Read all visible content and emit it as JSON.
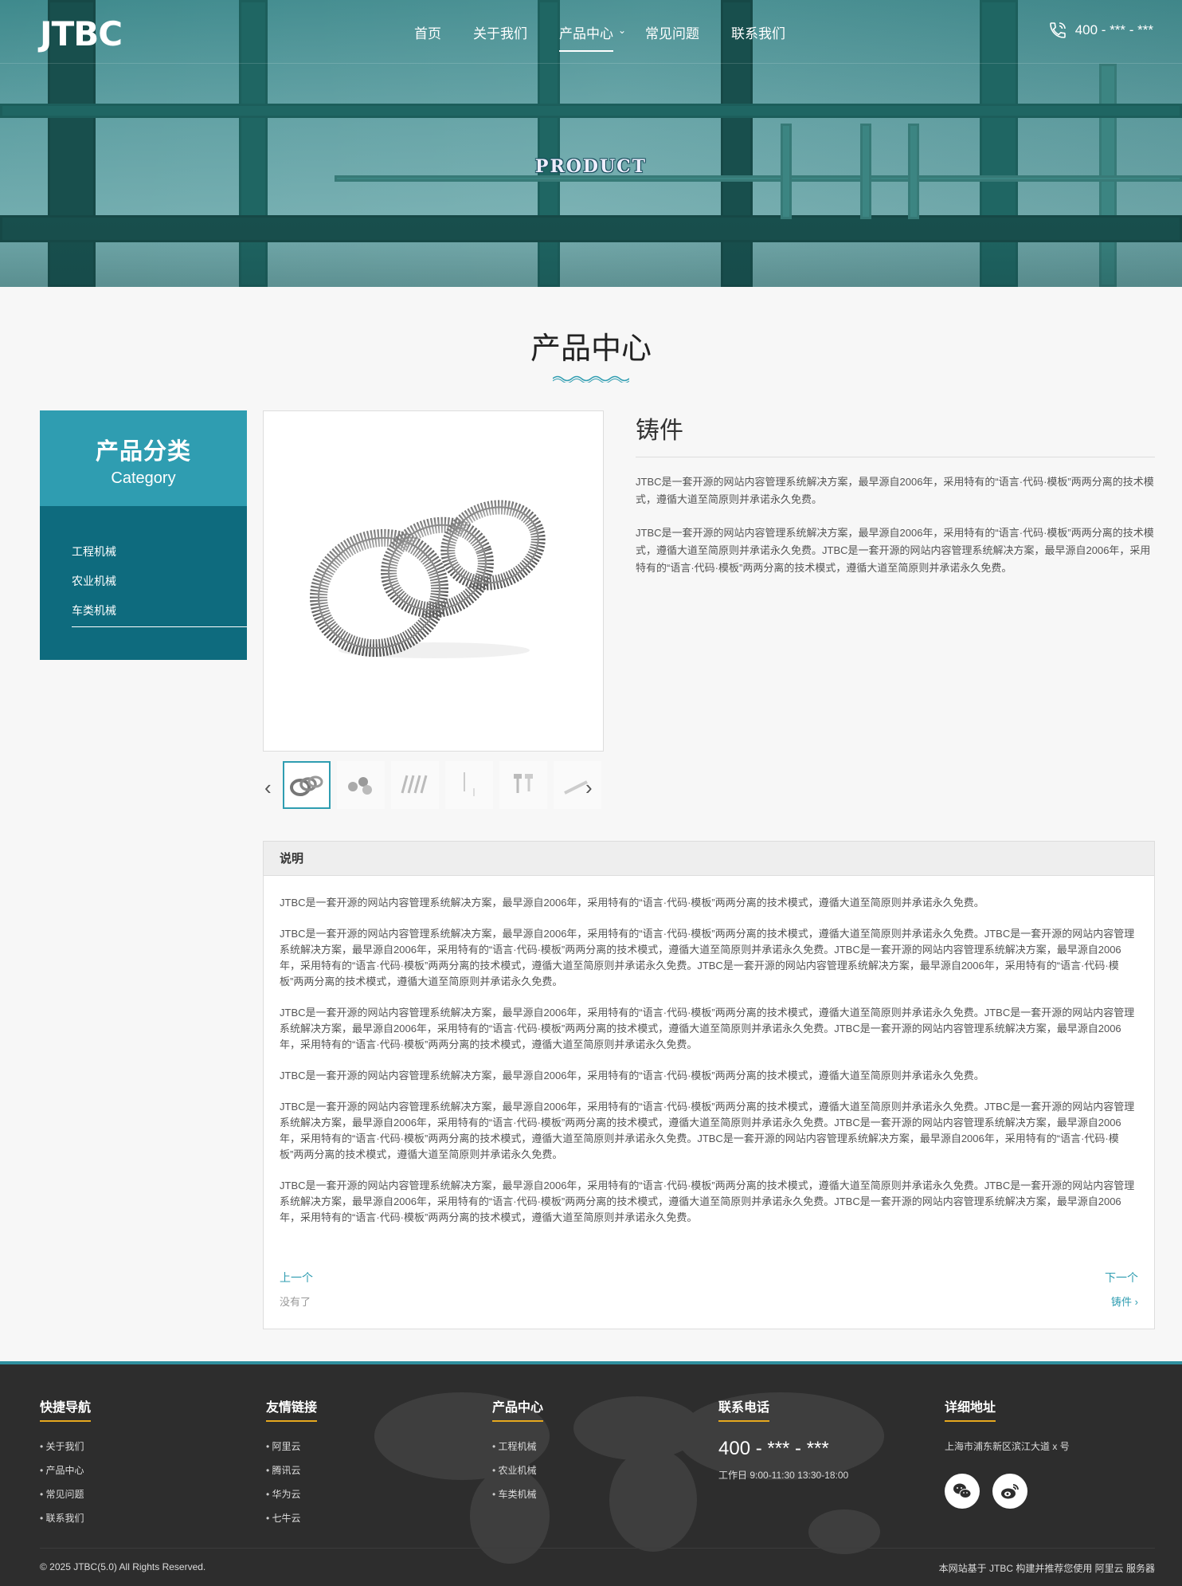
{
  "header": {
    "logo": "JTBC",
    "nav": [
      {
        "label": "首页"
      },
      {
        "label": "关于我们"
      },
      {
        "label": "产品中心"
      },
      {
        "label": "常见问题"
      },
      {
        "label": "联系我们"
      }
    ],
    "phone": "400 - *** - ***",
    "banner_label": "PRODUCT"
  },
  "page_title": "产品中心",
  "sidebar": {
    "title_cn": "产品分类",
    "title_en": "Category",
    "items": [
      {
        "label": "工程机械"
      },
      {
        "label": "农业机械"
      },
      {
        "label": "车类机械"
      }
    ]
  },
  "product": {
    "name": "铸件",
    "paragraphs": [
      "JTBC是一套开源的网站内容管理系统解决方案，最早源自2006年，采用特有的“语言·代码·模板”两两分离的技术模式，遵循大道至简原则并承诺永久免费。",
      "JTBC是一套开源的网站内容管理系统解决方案，最早源自2006年，采用特有的“语言·代码·模板”两两分离的技术模式，遵循大道至简原则并承诺永久免费。JTBC是一套开源的网站内容管理系统解决方案，最早源自2006年，采用特有的“语言·代码·模板”两两分离的技术模式，遵循大道至简原则并承诺永久免费。"
    ]
  },
  "description": {
    "heading": "说明",
    "paragraphs": [
      "JTBC是一套开源的网站内容管理系统解决方案，最早源自2006年，采用特有的“语言·代码·模板”两两分离的技术模式，遵循大道至简原则并承诺永久免费。",
      "JTBC是一套开源的网站内容管理系统解决方案，最早源自2006年，采用特有的“语言·代码·模板”两两分离的技术模式，遵循大道至简原则并承诺永久免费。JTBC是一套开源的网站内容管理系统解决方案，最早源自2006年，采用特有的“语言·代码·模板”两两分离的技术模式，遵循大道至简原则并承诺永久免费。JTBC是一套开源的网站内容管理系统解决方案，最早源自2006年，采用特有的“语言·代码·模板”两两分离的技术模式，遵循大道至简原则并承诺永久免费。JTBC是一套开源的网站内容管理系统解决方案，最早源自2006年，采用特有的“语言·代码·模板”两两分离的技术模式，遵循大道至简原则并承诺永久免费。",
      "JTBC是一套开源的网站内容管理系统解决方案，最早源自2006年，采用特有的“语言·代码·模板”两两分离的技术模式，遵循大道至简原则并承诺永久免费。JTBC是一套开源的网站内容管理系统解决方案，最早源自2006年，采用特有的“语言·代码·模板”两两分离的技术模式，遵循大道至简原则并承诺永久免费。JTBC是一套开源的网站内容管理系统解决方案，最早源自2006年，采用特有的“语言·代码·模板”两两分离的技术模式，遵循大道至简原则并承诺永久免费。",
      "JTBC是一套开源的网站内容管理系统解决方案，最早源自2006年，采用特有的“语言·代码·模板”两两分离的技术模式，遵循大道至简原则并承诺永久免费。",
      "JTBC是一套开源的网站内容管理系统解决方案，最早源自2006年，采用特有的“语言·代码·模板”两两分离的技术模式，遵循大道至简原则并承诺永久免费。JTBC是一套开源的网站内容管理系统解决方案，最早源自2006年，采用特有的“语言·代码·模板”两两分离的技术模式，遵循大道至简原则并承诺永久免费。JTBC是一套开源的网站内容管理系统解决方案，最早源自2006年，采用特有的“语言·代码·模板”两两分离的技术模式，遵循大道至简原则并承诺永久免费。JTBC是一套开源的网站内容管理系统解决方案，最早源自2006年，采用特有的“语言·代码·模板”两两分离的技术模式，遵循大道至简原则并承诺永久免费。",
      "JTBC是一套开源的网站内容管理系统解决方案，最早源自2006年，采用特有的“语言·代码·模板”两两分离的技术模式，遵循大道至简原则并承诺永久免费。JTBC是一套开源的网站内容管理系统解决方案，最早源自2006年，采用特有的“语言·代码·模板”两两分离的技术模式，遵循大道至简原则并承诺永久免费。JTBC是一套开源的网站内容管理系统解决方案，最早源自2006年，采用特有的“语言·代码·模板”两两分离的技术模式，遵循大道至简原则并承诺永久免费。"
    ],
    "prev_label": "上一个",
    "prev_value": "没有了",
    "next_label": "下一个",
    "next_value": "铸件"
  },
  "footer": {
    "quick_nav": {
      "title": "快捷导航",
      "items": [
        "关于我们",
        "产品中心",
        "常见问题",
        "联系我们"
      ]
    },
    "links": {
      "title": "友情链接",
      "items": [
        "阿里云",
        "腾讯云",
        "华为云",
        "七牛云"
      ]
    },
    "products": {
      "title": "产品中心",
      "items": [
        "工程机械",
        "农业机械",
        "车类机械"
      ]
    },
    "contact": {
      "title": "联系电话",
      "phone": "400 - *** - ***",
      "hours": "工作日 9:00-11:30 13:30-18:00"
    },
    "address": {
      "title": "详细地址",
      "text": "上海市浦东新区滨江大道 x 号"
    },
    "copyright": "© 2025 JTBC(5.0) All Rights Reserved.",
    "powered": "本网站基于 JTBC 构建并推荐您使用 阿里云 服务器"
  },
  "colors": {
    "accent": "#2f9db1",
    "sidebar_dark": "#0e6b7e",
    "footer_bg": "#2d2d2d",
    "footer_underline": "#e6a81e"
  }
}
